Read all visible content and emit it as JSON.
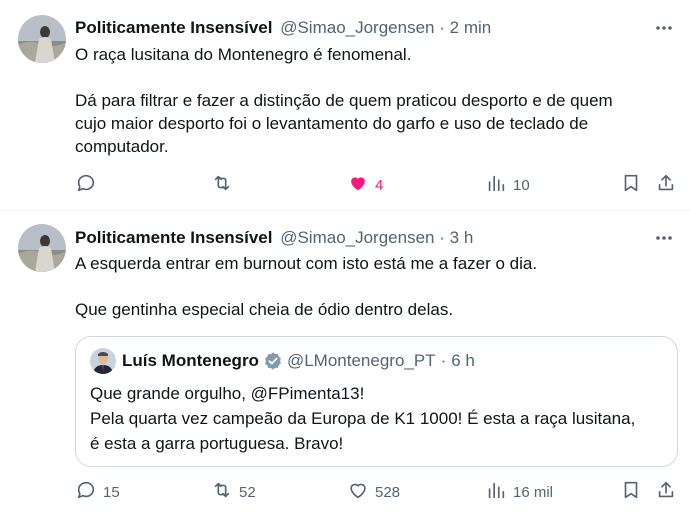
{
  "tweets": [
    {
      "name": "Politicamente Insensível",
      "handle": "@Simao_Jorgensen",
      "sep": "·",
      "time": "2 min",
      "text_lines": [
        "O raça lusitana do Montenegro é fenomenal.",
        "",
        "Dá para filtrar e fazer a distinção de quem praticou desporto e de quem",
        "cujo maior desporto foi o levantamento do garfo e uso de teclado de",
        "computador."
      ],
      "actions": {
        "replies": "",
        "retweets": "",
        "likes": "4",
        "views": "10"
      },
      "liked": true
    },
    {
      "name": "Politicamente Insensível",
      "handle": "@Simao_Jorgensen",
      "sep": "·",
      "time": "3 h",
      "text_lines": [
        "A esquerda entrar em burnout com isto está me a fazer o dia.",
        "",
        "Que gentinha especial cheia de ódio dentro delas."
      ],
      "quote": {
        "name": "Luís Montenegro",
        "handle": "@LMontenegro_PT",
        "sep": "·",
        "time": "6 h",
        "text_lines": [
          "Que grande orgulho, @FPimenta13!",
          "Pela quarta vez campeão da Europa de K1 1000! É esta a raça lusitana,",
          "é esta a garra portuguesa. Bravo!"
        ]
      },
      "actions": {
        "replies": "15",
        "retweets": "52",
        "likes": "528",
        "views": "16 mil"
      },
      "liked": false
    }
  ],
  "colors": {
    "text": "#0f1419",
    "secondary": "#536471",
    "like": "#f91880",
    "border": "#cfd9de",
    "divider": "#eff3f4"
  },
  "icons": [
    "more-icon",
    "reply-icon",
    "retweet-icon",
    "like-icon",
    "views-icon",
    "bookmark-icon",
    "share-icon",
    "verified-icon"
  ]
}
